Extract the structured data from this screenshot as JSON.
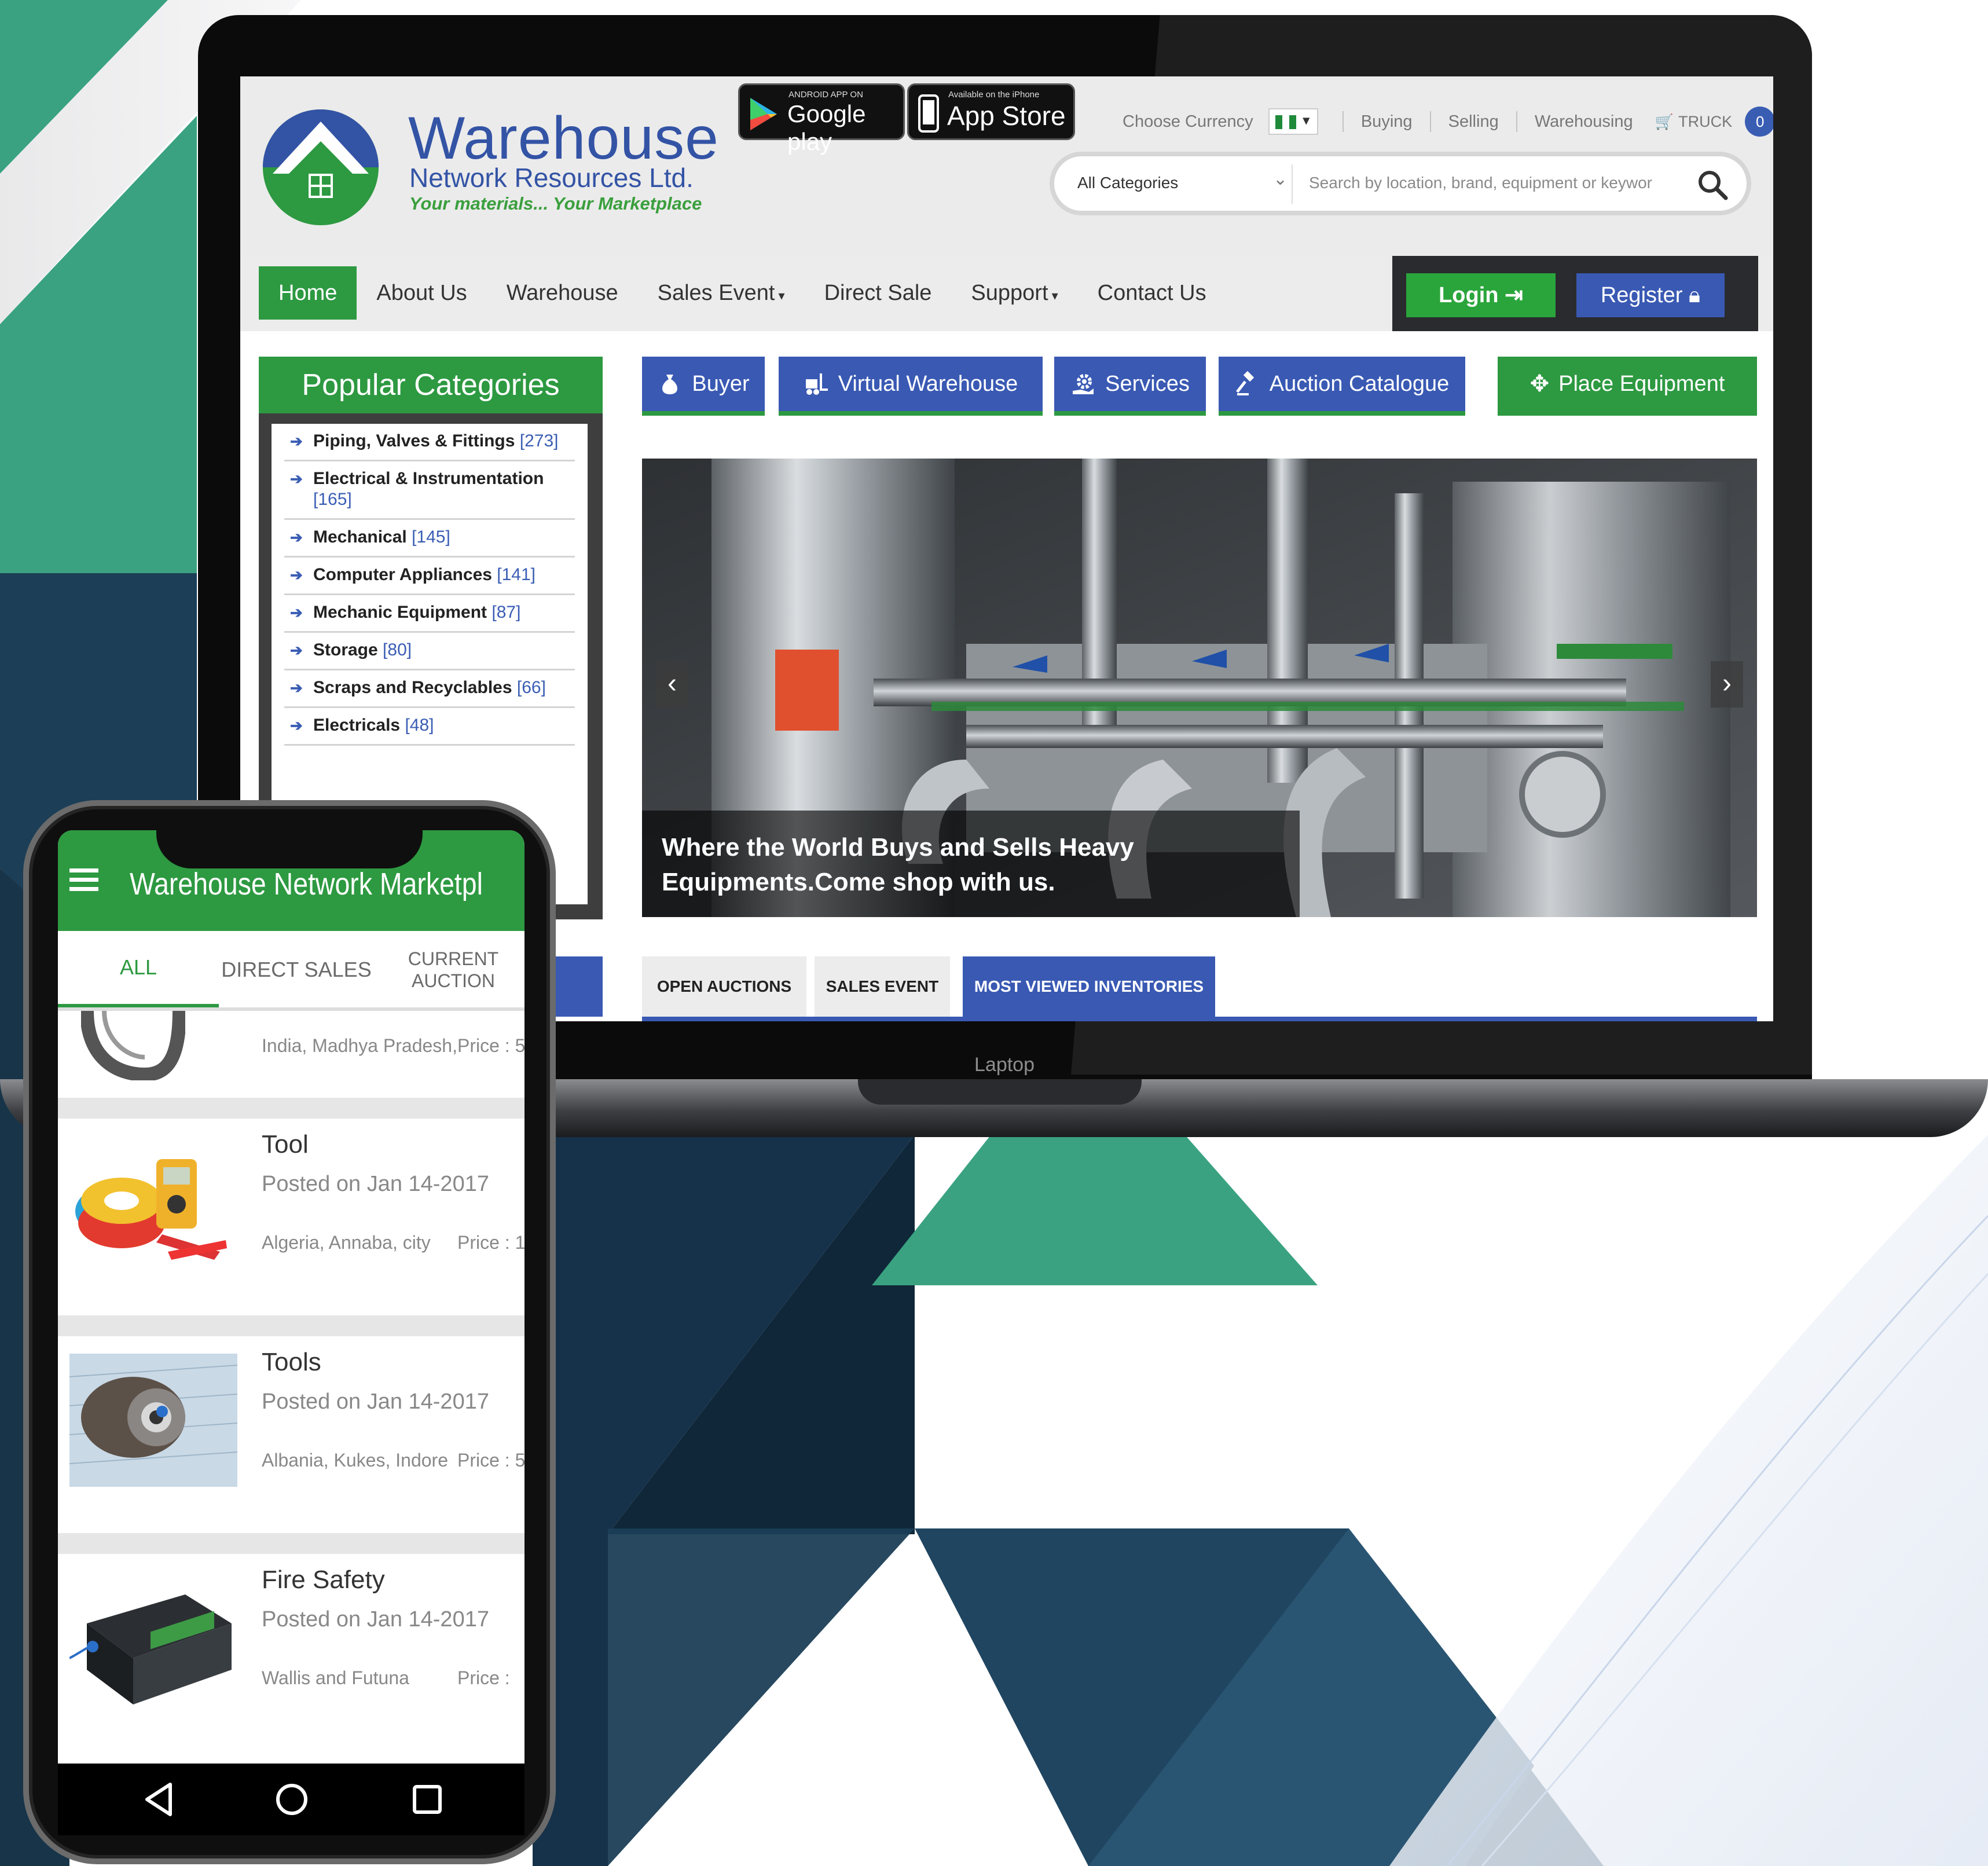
{
  "laptop": {
    "label": "Laptop"
  },
  "site": {
    "brand": {
      "name": "Warehouse",
      "sub": "Network Resources Ltd.",
      "tagline": "Your materials... Your Marketplace"
    },
    "stores": {
      "google": {
        "small": "ANDROID APP ON",
        "big": "Google play"
      },
      "apple": {
        "small": "Available on the iPhone",
        "big": "App Store"
      }
    },
    "top_links": {
      "currency_label": "Choose Currency",
      "buying": "Buying",
      "selling": "Selling",
      "warehousing": "Warehousing",
      "cart": "TRUCK",
      "cart_count": "0"
    },
    "search": {
      "category": "All Categories",
      "placeholder": "Search by location, brand, equipment or keywor"
    },
    "nav": [
      "Home",
      "About Us",
      "Warehouse",
      "Sales Event",
      "Direct Sale",
      "Support",
      "Contact Us"
    ],
    "auth": {
      "login": "Login",
      "register": "Register"
    },
    "categories": {
      "title": "Popular Categories",
      "items": [
        {
          "name": "Piping, Valves & Fittings",
          "count": "[273]"
        },
        {
          "name": "Electrical & Instrumentation",
          "count": "[165]"
        },
        {
          "name": "Mechanical",
          "count": "[145]"
        },
        {
          "name": "Computer Appliances",
          "count": "[141]"
        },
        {
          "name": "Mechanic Equipment",
          "count": "[87]"
        },
        {
          "name": "Storage",
          "count": "[80]"
        },
        {
          "name": "Scraps and Recyclables",
          "count": "[66]"
        },
        {
          "name": "Electricals",
          "count": "[48]"
        }
      ]
    },
    "role_tabs": [
      "Buyer",
      "Virtual Warehouse",
      "Services",
      "Auction Catalogue",
      "Place Equipment"
    ],
    "hero": {
      "caption_line1": "Where the World Buys and Sells Heavy",
      "caption_line2": "Equipments.Come shop with us."
    },
    "inventory_tabs": [
      "OPEN AUCTIONS",
      "SALES EVENT",
      "MOST VIEWED INVENTORIES"
    ]
  },
  "phone": {
    "app_title": "Warehouse Network Marketpl",
    "tabs": {
      "all": "ALL",
      "direct": "DIRECT SALES",
      "current_1": "CURRENT",
      "current_2": "AUCTION"
    },
    "partial": {
      "location": "India, Madhya Pradesh,",
      "price": "Price : 5"
    },
    "products": [
      {
        "title": "Tool",
        "date": "Posted on Jan 14-2017",
        "location": "Algeria, Annaba, city",
        "price": "Price : 1"
      },
      {
        "title": "Tools",
        "date": "Posted on Jan 14-2017",
        "location": "Albania, Kukes, Indore",
        "price": "Price : 5"
      },
      {
        "title": "Fire Safety",
        "date": "Posted on Jan 14-2017",
        "location": "Wallis and Futuna",
        "price": "Price :"
      }
    ]
  },
  "colors": {
    "brand_green": "#2d9941",
    "brand_blue": "#3959b3",
    "teal": "#3aa281",
    "navy": "#1c3e57"
  }
}
